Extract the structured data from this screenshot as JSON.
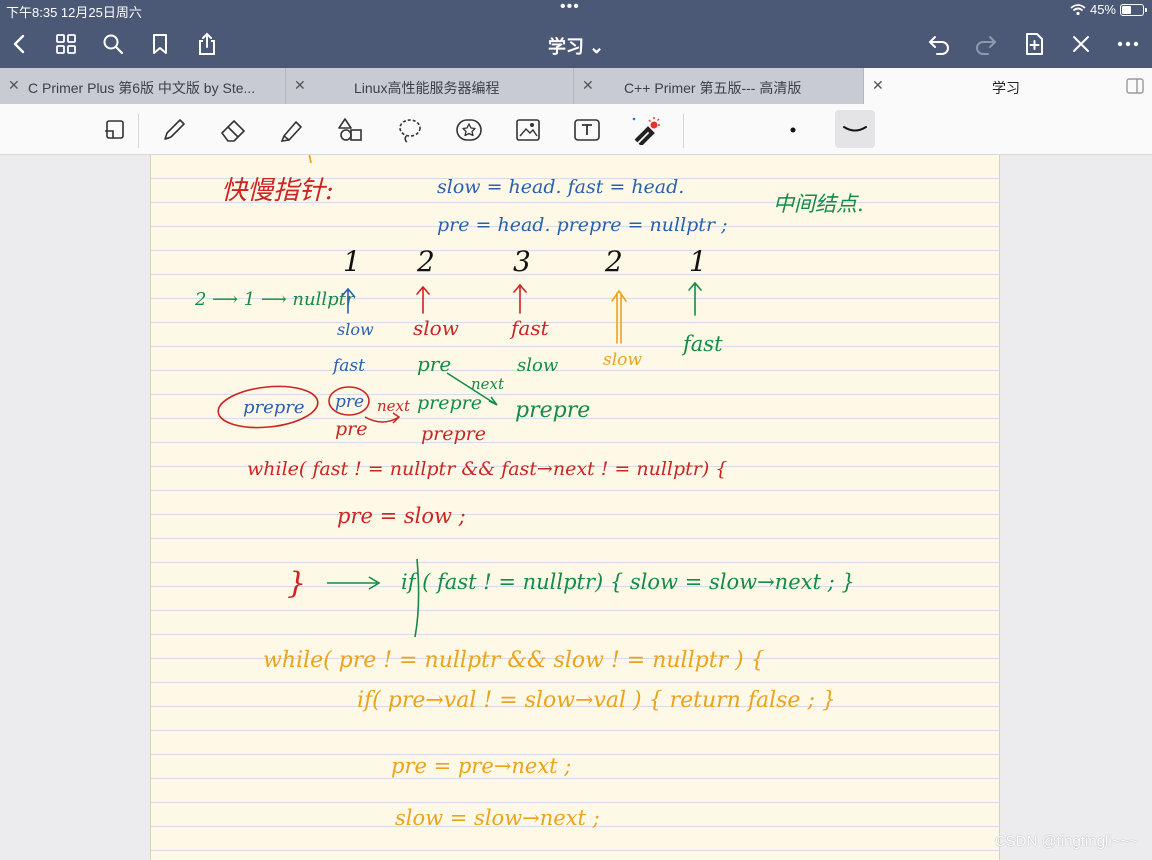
{
  "status": {
    "time": "下午8:35  12月25日周六",
    "battery": "45%"
  },
  "nav": {
    "title": "学习 ⌄"
  },
  "tabs": [
    {
      "label": "C   Primer Plus 第6版 中文版 by Ste..."
    },
    {
      "label": "Linux高性能服务器编程"
    },
    {
      "label": "C++ Primer 第五版--- 高清版"
    },
    {
      "label": "学习"
    }
  ],
  "colors": {
    "red": "#cc2424",
    "blue": "#2a5fb0",
    "green": "#168a4a",
    "orange": "#eba21e"
  },
  "notes": {
    "heading": "快慢指针:",
    "init1": "slow = head.   fast = head.",
    "init2": "pre = head.   prepre = nullptr ;",
    "midnote": "中间结点.",
    "nullchain": "2 ⟶ 1 ⟶ nullptr",
    "seq": [
      "1",
      "2",
      "3",
      "2",
      "1"
    ],
    "lab_slow1": "slow",
    "lab_fast1": "fast",
    "lab_slow2": "slow",
    "lab_pre2": "pre",
    "lab_fast3": "fast",
    "lab_slow3": "slow",
    "lab_slow4": "slow",
    "lab_fast5": "fast",
    "prepre_circled": "prepre",
    "pre_circled": "pre",
    "next_label": "next",
    "pre_below": "pre",
    "prepre_green": "prepre",
    "next_green": "next",
    "prepre_green2": "prepre",
    "prepre_red": "prepre",
    "while1": "while( fast ! = nullptr && fast→next ! = nullptr) {",
    "pre_slow": "pre = slow ;",
    "close_brace": "}",
    "if_fast": "if ( fast  ! = nullptr) {  slow = slow→next ; }",
    "while2": "while( pre ! = nullptr   &&  slow ! = nullptr ) {",
    "if_val": "if( pre→val  ! =  slow→val ) {  return false ; }",
    "pre_next": "pre = pre→next ;",
    "slow_next": "slow = slow→next ;"
  },
  "watermark": "CSDN @tingtingli~~~"
}
